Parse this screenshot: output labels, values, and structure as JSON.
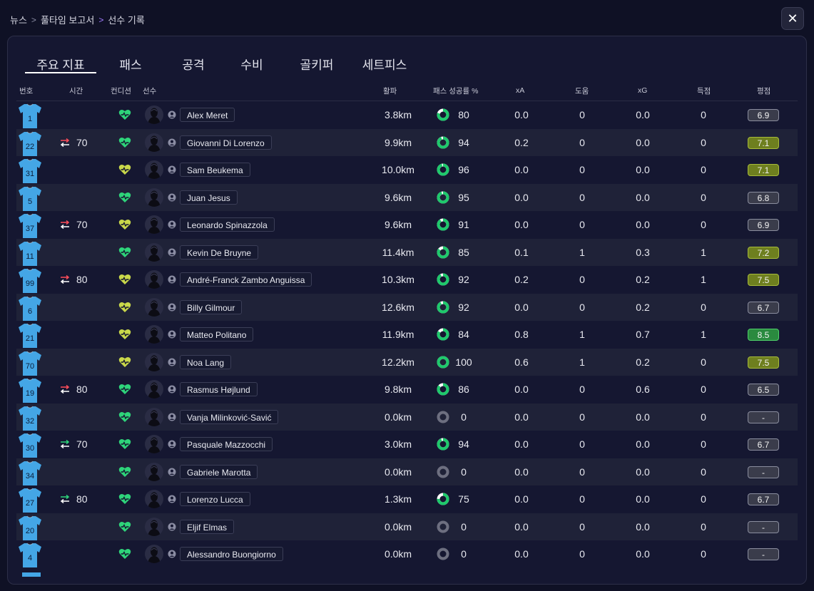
{
  "breadcrumb": {
    "items": [
      "뉴스",
      "풀타임 보고서",
      "선수 기록"
    ]
  },
  "close_label": "✕",
  "tabs": [
    "주요 지표",
    "패스",
    "공격",
    "수비",
    "골키퍼",
    "세트피스"
  ],
  "columns": {
    "number": "번호",
    "time": "시간",
    "condition": "컨디션",
    "player": "선수",
    "distance": "활파",
    "pass_pct": "패스 성공률 %",
    "xa": "xA",
    "assists": "도움",
    "xg": "xG",
    "goals": "득점",
    "rating": "평점"
  },
  "colors": {
    "accent": "#a07cff",
    "heart_green": "#2ed47a",
    "heart_yellow": "#c9d84a",
    "jersey": "#44a6e6",
    "ring_green": "#1ec96c",
    "ring_gray": "#6d6f80",
    "sub_out": "#ff4d5a",
    "sub_in": "#2ed47a",
    "rating_gray": "#3a3c4b",
    "rating_olive": "#6e7f1f",
    "rating_green": "#2a8a3f"
  },
  "players": [
    {
      "number": "1",
      "sub": "",
      "sub_min": "",
      "cond": "green",
      "name": "Alex Meret",
      "dist": "3.8km",
      "pass": "80",
      "xa": "0.0",
      "ast": "0",
      "xg": "0.0",
      "goals": "0",
      "rating": "6.9",
      "rating_color": "gray"
    },
    {
      "number": "22",
      "sub": "out",
      "sub_min": "70",
      "cond": "green",
      "name": "Giovanni Di Lorenzo",
      "dist": "9.9km",
      "pass": "94",
      "xa": "0.2",
      "ast": "0",
      "xg": "0.0",
      "goals": "0",
      "rating": "7.1",
      "rating_color": "olive"
    },
    {
      "number": "31",
      "sub": "",
      "sub_min": "",
      "cond": "yellow",
      "name": "Sam Beukema",
      "dist": "10.0km",
      "pass": "96",
      "xa": "0.0",
      "ast": "0",
      "xg": "0.0",
      "goals": "0",
      "rating": "7.1",
      "rating_color": "olive"
    },
    {
      "number": "5",
      "sub": "",
      "sub_min": "",
      "cond": "green",
      "name": "Juan Jesus",
      "dist": "9.6km",
      "pass": "95",
      "xa": "0.0",
      "ast": "0",
      "xg": "0.0",
      "goals": "0",
      "rating": "6.8",
      "rating_color": "gray"
    },
    {
      "number": "37",
      "sub": "out",
      "sub_min": "70",
      "cond": "yellow",
      "name": "Leonardo Spinazzola",
      "dist": "9.6km",
      "pass": "91",
      "xa": "0.0",
      "ast": "0",
      "xg": "0.0",
      "goals": "0",
      "rating": "6.9",
      "rating_color": "gray"
    },
    {
      "number": "11",
      "sub": "",
      "sub_min": "",
      "cond": "green",
      "name": "Kevin De Bruyne",
      "dist": "11.4km",
      "pass": "85",
      "xa": "0.1",
      "ast": "1",
      "xg": "0.3",
      "goals": "1",
      "rating": "7.2",
      "rating_color": "olive"
    },
    {
      "number": "99",
      "sub": "out",
      "sub_min": "80",
      "cond": "yellow",
      "name": "André-Franck Zambo Anguissa",
      "dist": "10.3km",
      "pass": "92",
      "xa": "0.2",
      "ast": "0",
      "xg": "0.2",
      "goals": "1",
      "rating": "7.5",
      "rating_color": "olive"
    },
    {
      "number": "6",
      "sub": "",
      "sub_min": "",
      "cond": "yellow",
      "name": "Billy Gilmour",
      "dist": "12.6km",
      "pass": "92",
      "xa": "0.0",
      "ast": "0",
      "xg": "0.2",
      "goals": "0",
      "rating": "6.7",
      "rating_color": "gray"
    },
    {
      "number": "21",
      "sub": "",
      "sub_min": "",
      "cond": "yellow",
      "name": "Matteo Politano",
      "dist": "11.9km",
      "pass": "84",
      "xa": "0.8",
      "ast": "1",
      "xg": "0.7",
      "goals": "1",
      "rating": "8.5",
      "rating_color": "green"
    },
    {
      "number": "70",
      "sub": "",
      "sub_min": "",
      "cond": "yellow",
      "name": "Noa Lang",
      "dist": "12.2km",
      "pass": "100",
      "xa": "0.6",
      "ast": "1",
      "xg": "0.2",
      "goals": "0",
      "rating": "7.5",
      "rating_color": "olive"
    },
    {
      "number": "19",
      "sub": "out",
      "sub_min": "80",
      "cond": "green",
      "name": "Rasmus Højlund",
      "dist": "9.8km",
      "pass": "86",
      "xa": "0.0",
      "ast": "0",
      "xg": "0.6",
      "goals": "0",
      "rating": "6.5",
      "rating_color": "gray"
    },
    {
      "number": "32",
      "sub": "",
      "sub_min": "",
      "cond": "green",
      "name": "Vanja Milinković-Savić",
      "dist": "0.0km",
      "pass": "0",
      "xa": "0.0",
      "ast": "0",
      "xg": "0.0",
      "goals": "0",
      "rating": "-",
      "rating_color": "gray"
    },
    {
      "number": "30",
      "sub": "in",
      "sub_min": "70",
      "cond": "green",
      "name": "Pasquale Mazzocchi",
      "dist": "3.0km",
      "pass": "94",
      "xa": "0.0",
      "ast": "0",
      "xg": "0.0",
      "goals": "0",
      "rating": "6.7",
      "rating_color": "gray"
    },
    {
      "number": "34",
      "sub": "",
      "sub_min": "",
      "cond": "green",
      "name": "Gabriele Marotta",
      "dist": "0.0km",
      "pass": "0",
      "xa": "0.0",
      "ast": "0",
      "xg": "0.0",
      "goals": "0",
      "rating": "-",
      "rating_color": "gray"
    },
    {
      "number": "27",
      "sub": "in",
      "sub_min": "80",
      "cond": "green",
      "name": "Lorenzo Lucca",
      "dist": "1.3km",
      "pass": "75",
      "xa": "0.0",
      "ast": "0",
      "xg": "0.0",
      "goals": "0",
      "rating": "6.7",
      "rating_color": "gray"
    },
    {
      "number": "20",
      "sub": "",
      "sub_min": "",
      "cond": "green",
      "name": "Eljif Elmas",
      "dist": "0.0km",
      "pass": "0",
      "xa": "0.0",
      "ast": "0",
      "xg": "0.0",
      "goals": "0",
      "rating": "-",
      "rating_color": "gray"
    },
    {
      "number": "4",
      "sub": "",
      "sub_min": "",
      "cond": "green",
      "name": "Alessandro Buongiorno",
      "dist": "0.0km",
      "pass": "0",
      "xa": "0.0",
      "ast": "0",
      "xg": "0.0",
      "goals": "0",
      "rating": "-",
      "rating_color": "gray"
    }
  ]
}
